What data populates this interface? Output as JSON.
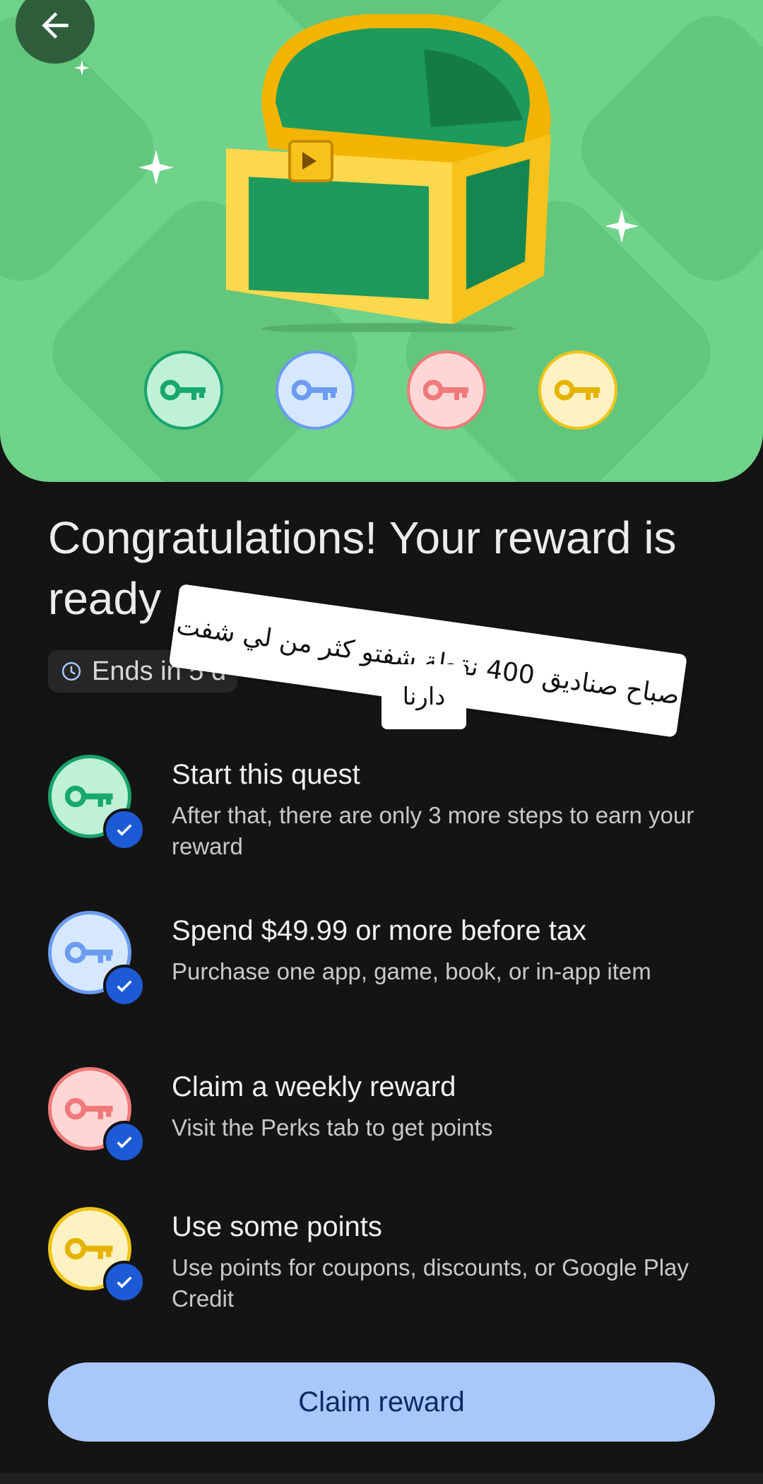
{
  "hero": {
    "key_badges": [
      {
        "name": "green-key",
        "fill": "#bff0d8",
        "stroke": "#1aa36c",
        "key": "#17a86b"
      },
      {
        "name": "blue-key",
        "fill": "#d6e8ff",
        "stroke": "#6c9cf0",
        "key": "#6c9cf0"
      },
      {
        "name": "red-key",
        "fill": "#ffd6d6",
        "stroke": "#f07a7a",
        "key": "#f07a7a"
      },
      {
        "name": "yellow-key",
        "fill": "#fff2c2",
        "stroke": "#f0c419",
        "key": "#e6b400"
      }
    ]
  },
  "title": "Congratulations! Your reward is ready",
  "chip": {
    "label": "Ends in 5 d",
    "icon": "clock-icon"
  },
  "sticker": {
    "line1": "صباح صناديق 400 نقطة شفتو كثر من لي شفت",
    "line2": "دارنا"
  },
  "steps": [
    {
      "title": "Start this quest",
      "desc": "After that, there are only 3 more steps to earn your reward",
      "icon": "key-icon",
      "fill": "#bff0d8",
      "stroke": "#1aa36c",
      "key": "#17a86b"
    },
    {
      "title": "Spend $49.99 or more before tax",
      "desc": "Purchase one app, game, book, or in-app item",
      "icon": "key-icon",
      "fill": "#d6e8ff",
      "stroke": "#6c9cf0",
      "key": "#6c9cf0"
    },
    {
      "title": "Claim a weekly reward",
      "desc": "Visit the Perks tab to get points",
      "icon": "key-icon",
      "fill": "#ffd6d6",
      "stroke": "#f07a7a",
      "key": "#f07a7a"
    },
    {
      "title": "Use some points",
      "desc": "Use points for coupons, discounts, or Google Play Credit",
      "icon": "key-icon",
      "fill": "#fff2c2",
      "stroke": "#f0c419",
      "key": "#e6b400"
    }
  ],
  "claim_button": {
    "label": "Claim reward"
  },
  "colors": {
    "hero": "#6fd38b",
    "button": "#a8c7fa",
    "check": "#1d5bd6",
    "background": "#141414"
  }
}
